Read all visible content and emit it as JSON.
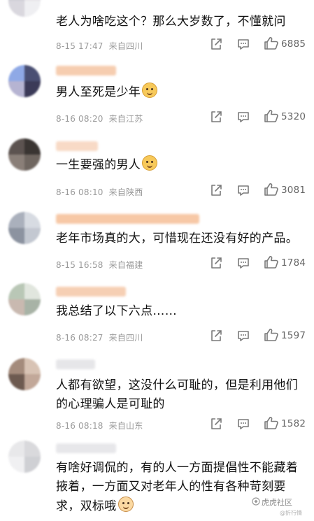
{
  "comments": [
    {
      "text_lines": [
        "老人为啥吃这个？那么大岁数了，不懂就问"
      ],
      "emoji": "",
      "date": "8-15 17:47",
      "location": "来自四川",
      "likes": "6885",
      "avatar_colors": [
        "#cfcfd6",
        "#e6e3e8",
        "#d9d7de",
        "#efeff2"
      ],
      "name_blur_color": "#ffffff"
    },
    {
      "text_lines": [
        "男人至死是少年"
      ],
      "emoji": "doge-icon",
      "date": "8-16 08:20",
      "location": "来自江苏",
      "likes": "5320",
      "avatar_colors": [
        "#8fa9e6",
        "#4a4f73",
        "#b6b4d2",
        "#3b3a58"
      ],
      "name_blur_color": "#f6cdb0"
    },
    {
      "text_lines": [
        "一生要强的男人"
      ],
      "emoji": "doge-icon",
      "date": "8-16 08:10",
      "location": "来自陕西",
      "likes": "3081",
      "avatar_colors": [
        "#5c5350",
        "#3a3532",
        "#8a7f78",
        "#6f6660"
      ],
      "name_blur_color": "#f8dac6"
    },
    {
      "text_lines": [
        "老年市场真的大，可惜现在还没有好的产品。"
      ],
      "emoji": "",
      "date": "8-15 16:58",
      "location": "来自福建",
      "likes": "1784",
      "avatar_colors": [
        "#aab0bc",
        "#d7dbe2",
        "#8c93a0",
        "#c3c8d1"
      ],
      "name_blur_color": "#f7c8a6"
    },
    {
      "text_lines": [
        "我总结了以下六点……"
      ],
      "emoji": "",
      "date": "8-16 08:27",
      "location": "来自四川",
      "likes": "1597",
      "avatar_colors": [
        "#b9c7b6",
        "#e1e6de",
        "#c9b9b0",
        "#a8b3a6"
      ],
      "name_blur_color": "#f6cfb4"
    },
    {
      "text_lines": [
        "人都有欲望，这没什么可耻的，但是利用他们",
        "的心理骗人是可耻的"
      ],
      "emoji": "",
      "date": "8-16 08:18",
      "location": "来自山东",
      "likes": "1582",
      "avatar_colors": [
        "#a48b7c",
        "#d8c3b4",
        "#6d5a50",
        "#c2a899"
      ],
      "name_blur_color": "#e6e6e9"
    },
    {
      "text_lines": [
        "有啥好调侃的，有的人一方面提倡性不能藏着",
        "掖着，一方面又对老年人的性有各种苛刻要",
        "求，双标哦"
      ],
      "emoji": "baby-icon",
      "date": "",
      "location": "",
      "likes": "",
      "avatar_colors": [
        "#e8e8ea",
        "#d9d9dc",
        "#f0f0f2",
        "#cfd0d4"
      ],
      "name_blur_color": "#e7e7ea"
    }
  ],
  "watermark": {
    "main": "虎虎社区",
    "sub": "@折行情"
  },
  "colors": {
    "text": "#111111",
    "meta": "#9a9a9a",
    "icon": "#7a7a7a"
  }
}
